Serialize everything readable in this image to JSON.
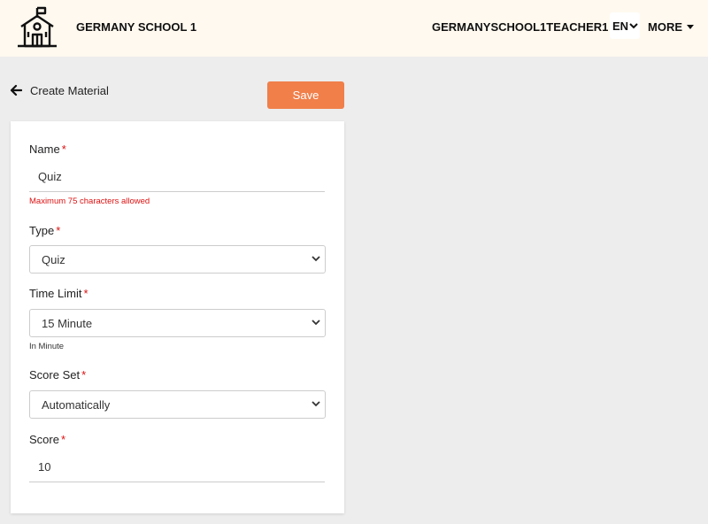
{
  "header": {
    "school_name": "GERMANY SCHOOL 1",
    "username": "GERMANYSCHOOL1TEACHER1",
    "language": "EN",
    "more_label": "MORE"
  },
  "page": {
    "title": "Create Material",
    "save_label": "Save"
  },
  "form": {
    "name": {
      "label": "Name",
      "required_mark": "*",
      "value": "Quiz",
      "helper": "Maximum 75 characters allowed"
    },
    "type": {
      "label": "Type",
      "required_mark": "*",
      "value": "Quiz"
    },
    "time_limit": {
      "label": "Time Limit",
      "required_mark": "*",
      "value": "15 Minute",
      "helper": "In Minute"
    },
    "score_set": {
      "label": "Score Set",
      "required_mark": "*",
      "value": "Automatically"
    },
    "score": {
      "label": "Score",
      "required_mark": "*",
      "value": "10"
    }
  },
  "colors": {
    "accent": "#f07f4a",
    "header_bg": "#fff9ef",
    "page_bg": "#ededed",
    "error": "#dd1111"
  },
  "icons": {
    "logo": "school-building-icon",
    "back": "arrow-left-icon",
    "dropdown": "chevron-down-icon"
  }
}
